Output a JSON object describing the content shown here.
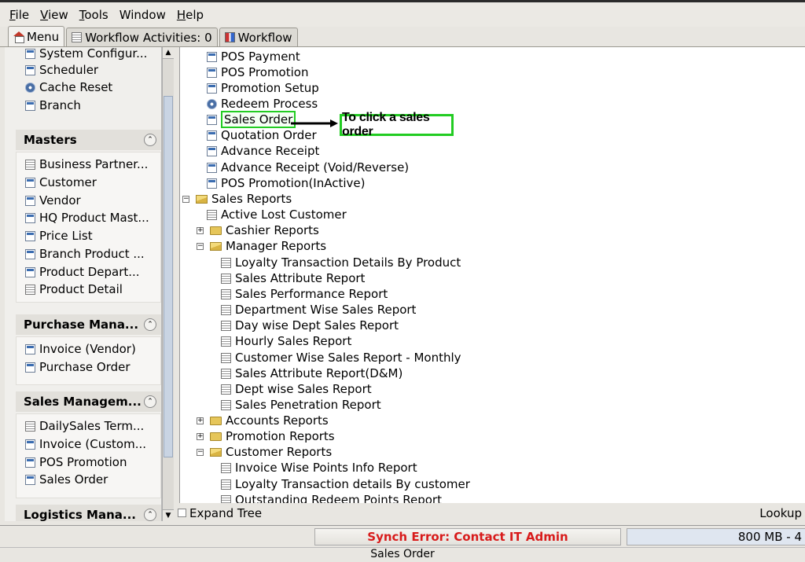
{
  "menubar": {
    "file": "File",
    "view": "View",
    "tools": "Tools",
    "window": "Window",
    "help": "Help"
  },
  "tabs": {
    "menu": "Menu",
    "workflow_activities": "Workflow Activities: 0",
    "workflow": "Workflow"
  },
  "sidebar": {
    "top_items": [
      "System Configur...",
      "Scheduler",
      "Cache Reset",
      "Branch"
    ],
    "masters": {
      "title": "Masters",
      "items": [
        "Business Partner...",
        "Customer",
        "Vendor",
        "HQ Product Mast...",
        "Price List",
        "Branch Product ...",
        "Product Depart...",
        "Product Detail"
      ]
    },
    "purchase": {
      "title": "Purchase Mana...",
      "items": [
        "Invoice (Vendor)",
        "Purchase Order"
      ]
    },
    "sales": {
      "title": "Sales Managem...",
      "items": [
        "DailySales Term...",
        "Invoice (Custom...",
        "POS Promotion",
        "Sales Order"
      ]
    },
    "logistics": {
      "title": "Logistics Mana..."
    }
  },
  "tree": {
    "items": [
      "POS Payment",
      "POS Promotion",
      "Promotion Setup",
      "Redeem Process",
      "Sales Order",
      "Quotation Order",
      "Advance Receipt",
      "Advance Receipt (Void/Reverse)",
      "POS Promotion(InActive)"
    ],
    "sales_reports": "Sales Reports",
    "active_lost": "Active Lost Customer",
    "cashier_reports": "Cashier Reports",
    "manager_reports": "Manager Reports",
    "manager_items": [
      "Loyalty Transaction Details By Product",
      "Sales Attribute Report",
      "Sales Performance Report",
      "Department Wise Sales Report",
      "Day wise Dept Sales Report",
      "Hourly Sales Report",
      "Customer Wise Sales Report - Monthly",
      "Sales Attribute Report(D&M)",
      "Dept wise Sales Report",
      "Sales Penetration Report"
    ],
    "accounts_reports": "Accounts Reports",
    "promotion_reports": "Promotion Reports",
    "customer_reports": "Customer Reports",
    "customer_items": [
      "Invoice Wise Points Info Report",
      "Loyalty Transaction details By customer",
      "Outstanding Redeem Points Report"
    ]
  },
  "annotation": {
    "callout": "To click a sales order",
    "color": "#22cc22"
  },
  "footer": {
    "expand_tree": "Expand Tree",
    "lookup": "Lookup",
    "sync_error": "Synch Error: Contact IT Admin",
    "memory": "800 MB - 4",
    "window_title": "Sales Order"
  }
}
